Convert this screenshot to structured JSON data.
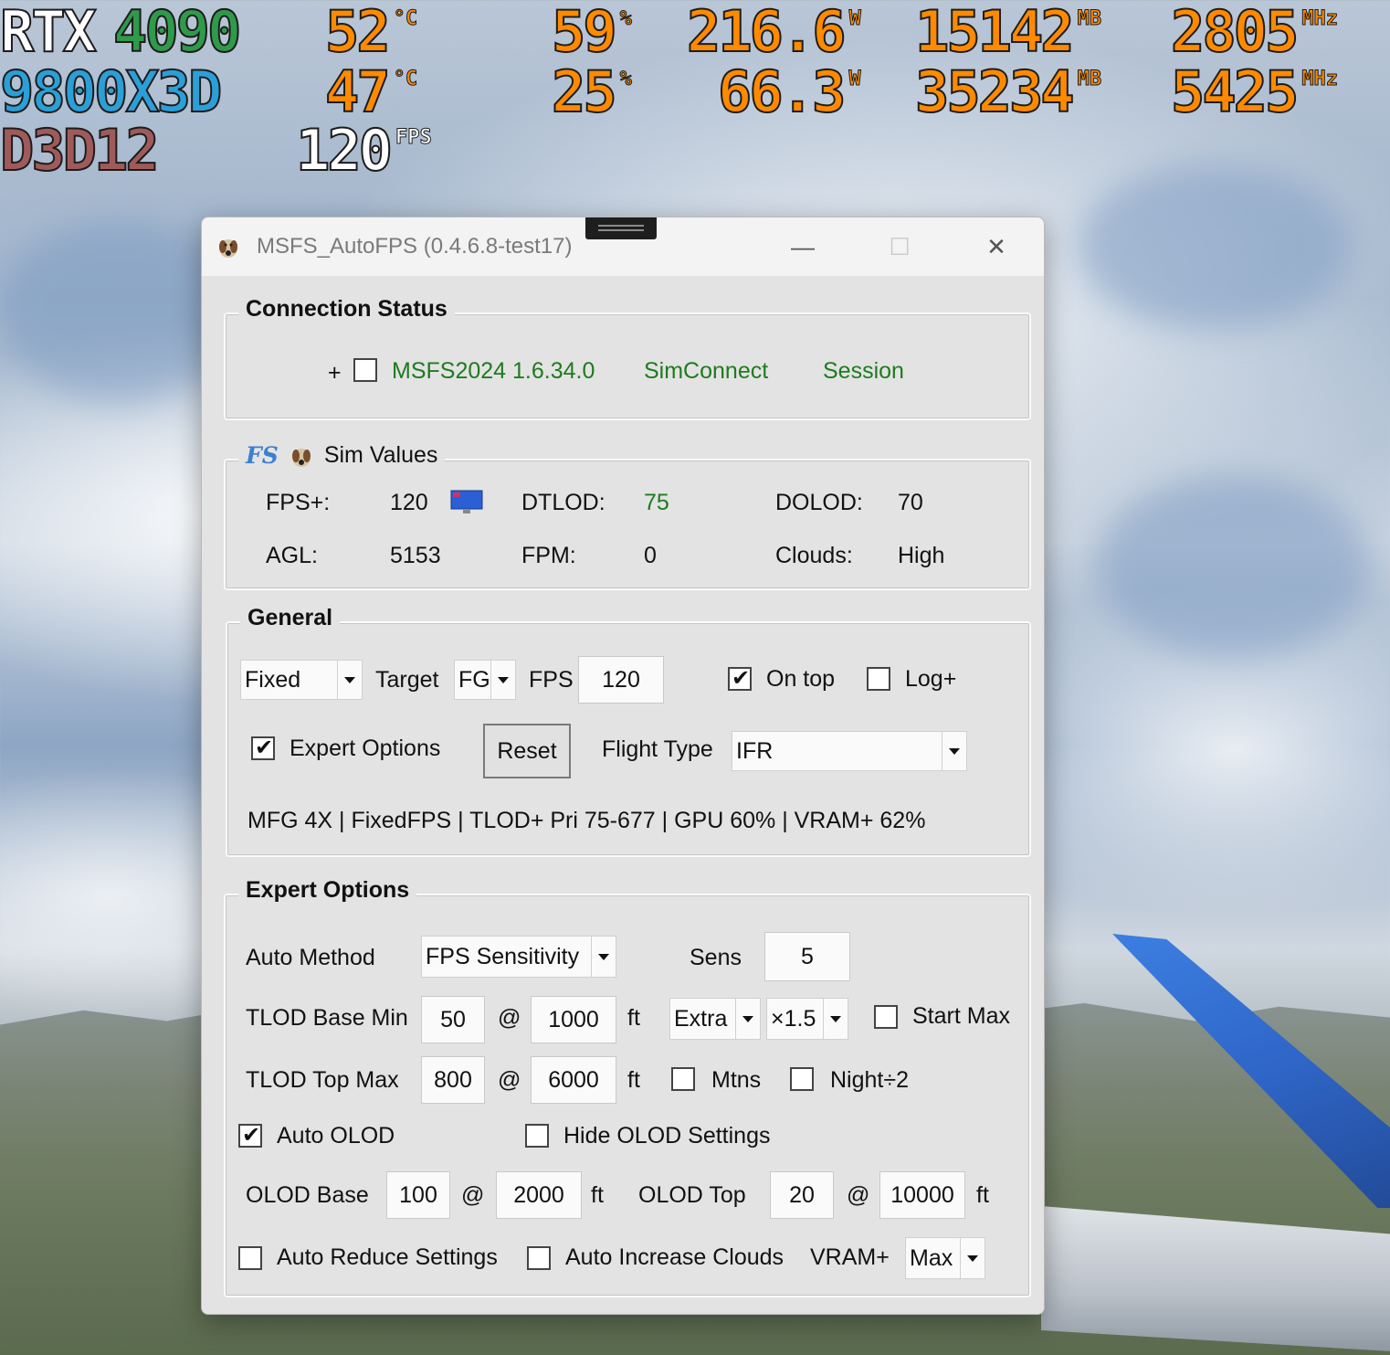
{
  "osd": {
    "row1": {
      "name": "RTX",
      "model": "4090",
      "temp": "52",
      "temp_unit": "°C",
      "load": "59",
      "load_unit": "%",
      "power": "216.6",
      "power_unit": "W",
      "mem": "15142",
      "mem_unit": "MB",
      "clock": "2805",
      "clock_unit": "MHz"
    },
    "row2": {
      "name": "9800X3D",
      "temp": "47",
      "temp_unit": "°C",
      "load": "25",
      "load_unit": "%",
      "power": "66.3",
      "power_unit": "W",
      "mem": "35234",
      "mem_unit": "MB",
      "clock": "5425",
      "clock_unit": "MHz"
    },
    "row3": {
      "api": "D3D12",
      "fps": "120",
      "fps_unit": "FPS"
    },
    "colors": {
      "gpu_name": "#ffffff",
      "gpu_model": "#2e9a4a",
      "cpu": "#2a9fd8",
      "api": "#a05a5a",
      "value": "#ff8a00"
    }
  },
  "window": {
    "title": "MSFS_AutoFPS (0.4.6.8-test17)",
    "controls": {
      "minimize": "—",
      "maximize": "☐",
      "close": "✕"
    }
  },
  "connection": {
    "legend": "Connection Status",
    "plus": "+",
    "sim": "MSFS2024 1.6.34.0",
    "simconnect": "SimConnect",
    "session": "Session"
  },
  "simvalues": {
    "legend": "Sim Values",
    "fs_icon_text": "FS",
    "fps_label": "FPS+:",
    "fps_value": "120",
    "dtlod_label": "DTLOD:",
    "dtlod_value": "75",
    "dolod_label": "DOLOD:",
    "dolod_value": "70",
    "agl_label": "AGL:",
    "agl_value": "5153",
    "fpm_label": "FPM:",
    "fpm_value": "0",
    "clouds_label": "Clouds:",
    "clouds_value": "High"
  },
  "general": {
    "legend": "General",
    "mode": "Fixed",
    "target_label": "Target",
    "target_value": "FG",
    "fps_label": "FPS",
    "fps_value": "120",
    "ontop_label": "On top",
    "ontop_checked": true,
    "log_label": "Log+",
    "log_checked": false,
    "expert_label": "Expert Options",
    "expert_checked": true,
    "reset_label": "Reset",
    "flight_type_label": "Flight Type",
    "flight_type_value": "IFR",
    "status_line": "MFG 4X | FixedFPS | TLOD+ Pri 75-677 | GPU 60% | VRAM+ 62%"
  },
  "expert": {
    "legend": "Expert Options",
    "auto_method_label": "Auto Method",
    "auto_method_value": "FPS Sensitivity",
    "sens_label": "Sens",
    "sens_value": "5",
    "tlod_base_label": "TLOD Base Min",
    "tlod_base_value": "50",
    "at1": "@",
    "tlod_base_alt": "1000",
    "ft1": "ft",
    "extra_value": "Extra",
    "mult_value": "×1.5",
    "start_max_label": "Start Max",
    "start_max_checked": false,
    "tlod_top_label": "TLOD Top Max",
    "tlod_top_value": "800",
    "at2": "@",
    "tlod_top_alt": "6000",
    "ft2": "ft",
    "mtns_label": "Mtns",
    "mtns_checked": false,
    "night_label": "Night÷2",
    "night_checked": false,
    "auto_olod_label": "Auto OLOD",
    "auto_olod_checked": true,
    "hide_olod_label": "Hide OLOD Settings",
    "hide_olod_checked": false,
    "olod_base_label": "OLOD Base",
    "olod_base_value": "100",
    "at3": "@",
    "olod_base_alt": "2000",
    "ft3": "ft",
    "olod_top_label": "OLOD Top",
    "olod_top_value": "20",
    "at4": "@",
    "olod_top_alt": "10000",
    "ft4": "ft",
    "auto_reduce_label": "Auto Reduce Settings",
    "auto_reduce_checked": false,
    "auto_increase_label": "Auto Increase Clouds",
    "auto_increase_checked": false,
    "vram_label": "VRAM+",
    "vram_value": "Max"
  }
}
